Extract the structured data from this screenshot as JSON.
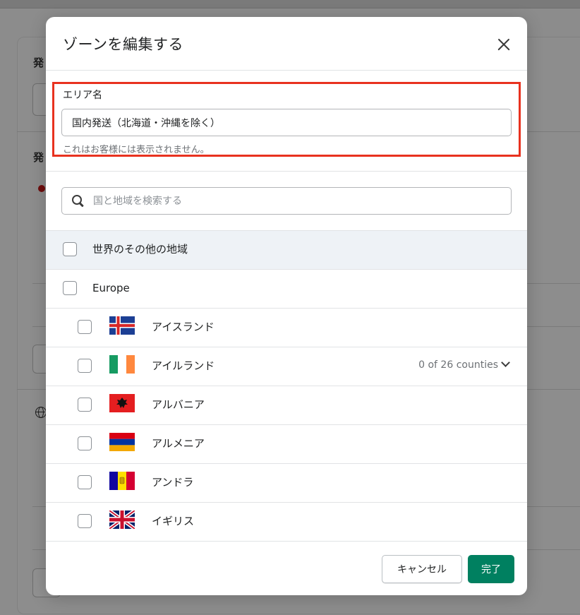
{
  "background": {
    "label_1": "発",
    "label_2": "発"
  },
  "modal": {
    "title": "ゾーンを編集する",
    "area_name": {
      "label": "エリア名",
      "value": "国内発送（北海道・沖縄を除く）",
      "help": "これはお客様には表示されません。"
    },
    "search": {
      "placeholder": "国と地域を検索する"
    },
    "world_row": {
      "label": "世界のその他の地域"
    },
    "region_row": {
      "label": "Europe"
    },
    "countries": [
      {
        "name": "アイスランド",
        "flag": "iceland-flag"
      },
      {
        "name": "アイルランド",
        "flag": "ireland-flag",
        "counties": "0 of 26 counties"
      },
      {
        "name": "アルバニア",
        "flag": "albania-flag"
      },
      {
        "name": "アルメニア",
        "flag": "armenia-flag"
      },
      {
        "name": "アンドラ",
        "flag": "andorra-flag"
      },
      {
        "name": "イギリス",
        "flag": "uk-flag"
      }
    ],
    "footer": {
      "cancel_label": "キャンセル",
      "done_label": "完了"
    }
  },
  "colors": {
    "highlight": "#e8321f",
    "primary": "#008060",
    "world_row_bg": "#eef2f6"
  }
}
